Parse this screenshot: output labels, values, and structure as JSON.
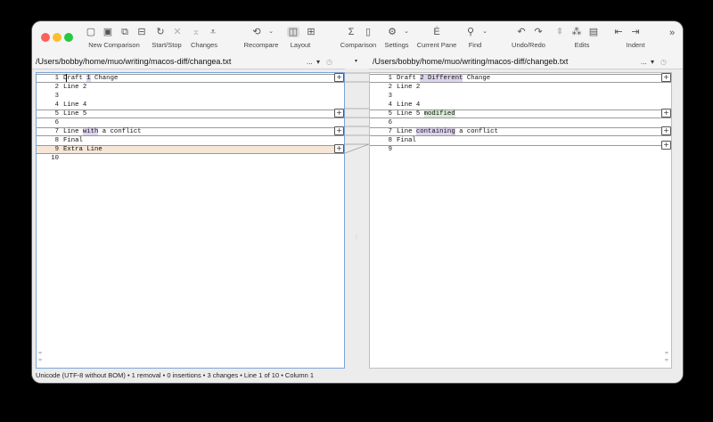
{
  "toolbar": {
    "groups": [
      {
        "label": "New Comparison"
      },
      {
        "label": "Start/Stop"
      },
      {
        "label": "Changes"
      },
      {
        "label": "Recompare"
      },
      {
        "label": "Layout"
      },
      {
        "label": "Comparison"
      },
      {
        "label": "Settings"
      },
      {
        "label": "Current Pane"
      },
      {
        "label": "Find"
      },
      {
        "label": "Undo/Redo"
      },
      {
        "label": "Edits"
      },
      {
        "label": "Indent"
      }
    ],
    "overflow": "»"
  },
  "left": {
    "path": "/Users/bobby/home/muo/writing/macos-diff/changea.txt",
    "controls": "...",
    "rows": [
      {
        "n": "1",
        "parts": [
          {
            "t": "Draft "
          },
          {
            "t": "1",
            "h": "p"
          },
          {
            "t": " Change"
          }
        ]
      },
      {
        "n": "2",
        "parts": [
          {
            "t": "Line 2"
          }
        ]
      },
      {
        "n": "3",
        "parts": [
          {
            "t": ""
          }
        ]
      },
      {
        "n": "4",
        "parts": [
          {
            "t": "Line 4"
          }
        ]
      },
      {
        "n": "5",
        "parts": [
          {
            "t": "Line 5"
          }
        ]
      },
      {
        "n": "6",
        "parts": [
          {
            "t": ""
          }
        ]
      },
      {
        "n": "7",
        "parts": [
          {
            "t": "Line "
          },
          {
            "t": "with",
            "h": "p"
          },
          {
            "t": " a conflict"
          }
        ]
      },
      {
        "n": "8",
        "parts": [
          {
            "t": "Final"
          }
        ]
      },
      {
        "n": "9",
        "parts": [
          {
            "t": "Extra Line"
          }
        ]
      },
      {
        "n": "10",
        "parts": [
          {
            "t": ""
          }
        ]
      }
    ]
  },
  "right": {
    "path": "/Users/bobby/home/muo/writing/macos-diff/changeb.txt",
    "controls": "...",
    "rows": [
      {
        "n": "1",
        "parts": [
          {
            "t": "Draft "
          },
          {
            "t": "2 Different",
            "h": "p"
          },
          {
            "t": " Change"
          }
        ]
      },
      {
        "n": "2",
        "parts": [
          {
            "t": "Line 2"
          }
        ]
      },
      {
        "n": "3",
        "parts": [
          {
            "t": ""
          }
        ]
      },
      {
        "n": "4",
        "parts": [
          {
            "t": "Line 4"
          }
        ]
      },
      {
        "n": "5",
        "parts": [
          {
            "t": "Line 5 "
          },
          {
            "t": "modified",
            "h": "g"
          }
        ]
      },
      {
        "n": "6",
        "parts": [
          {
            "t": ""
          }
        ]
      },
      {
        "n": "7",
        "parts": [
          {
            "t": "Line "
          },
          {
            "t": "containing",
            "h": "p"
          },
          {
            "t": " a conflict"
          }
        ]
      },
      {
        "n": "8",
        "parts": [
          {
            "t": "Final"
          }
        ]
      },
      {
        "n": "9",
        "parts": [
          {
            "t": ""
          }
        ]
      }
    ]
  },
  "status": {
    "text": "Unicode (UTF-8 without BOM) • 1 removal • 0 insertions • 3 changes • Line 1 of 10 • Column 1"
  },
  "colors": {
    "focus_border": "#7aa5d8",
    "change_highlight": "#ded4ee",
    "insert_highlight": "#d8eed6",
    "removed_line": "#f5e6d8"
  }
}
